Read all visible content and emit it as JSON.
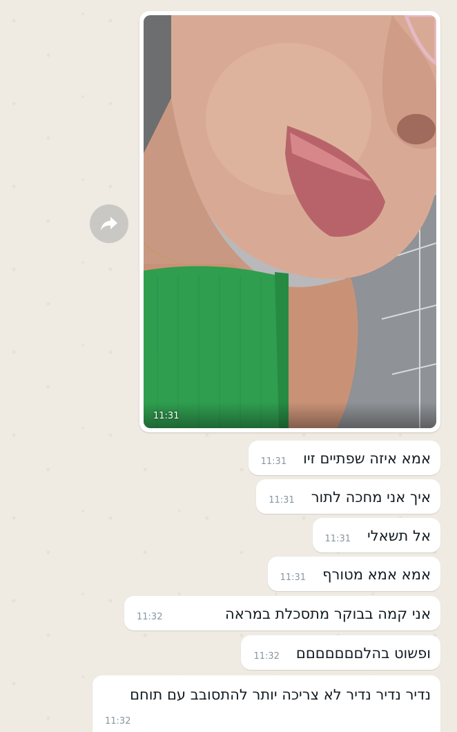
{
  "media": {
    "time": "11:31"
  },
  "forward": {
    "icon": "forward-icon"
  },
  "messages": [
    {
      "text": "אמא איזה שפתיים זיו",
      "time": "11:31"
    },
    {
      "text": "איך אני מחכה לתור",
      "time": "11:31"
    },
    {
      "text": "אל תשאלי",
      "time": "11:31"
    },
    {
      "text": "אמא אמא מטורף",
      "time": "11:31"
    },
    {
      "text": "אני קמה בבוקר מתסכלת במראה",
      "time": "11:32"
    },
    {
      "text": "ופשוט בהלםםםםםםם",
      "time": "11:32"
    },
    {
      "text": "נדיר נדיר נדיר לא צריכה יותר להתסובב עם תוחם",
      "time": "11:32"
    }
  ]
}
